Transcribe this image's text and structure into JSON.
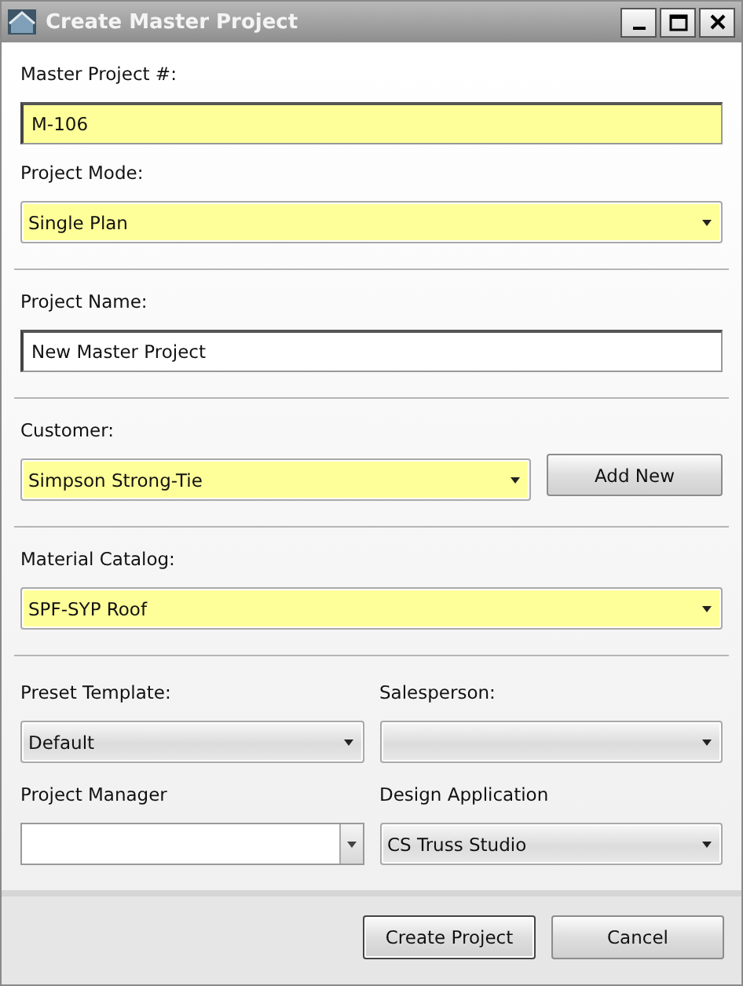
{
  "window": {
    "title": "Create Master Project"
  },
  "sections": [
    {
      "kind": "stack",
      "fields": [
        {
          "label": "Master Project #:",
          "kind": "text",
          "value": "M-106",
          "required": true
        },
        {
          "label": "Project Mode:",
          "kind": "dropdown",
          "value": "Single Plan",
          "required": true
        }
      ]
    },
    {
      "kind": "stack",
      "fields": [
        {
          "label": "Project Name:",
          "kind": "text",
          "value": "New Master Project",
          "required": false
        }
      ]
    },
    {
      "kind": "with-button",
      "button": "Add New",
      "fields": [
        {
          "label": "Customer:",
          "kind": "dropdown",
          "value": "Simpson Strong-Tie",
          "required": true
        }
      ]
    },
    {
      "kind": "stack",
      "fields": [
        {
          "label": "Material Catalog:",
          "kind": "dropdown",
          "value": "SPF-SYP Roof",
          "required": true
        }
      ]
    },
    {
      "kind": "grid",
      "fields": [
        {
          "label": "Preset Template:",
          "kind": "dropdown",
          "value": "Default",
          "required": false
        },
        {
          "label": "Salesperson:",
          "kind": "dropdown",
          "required": false
        },
        {
          "label": "Project Manager",
          "kind": "combo",
          "required": false
        },
        {
          "label": "Design Application",
          "kind": "dropdown",
          "value": "CS Truss Studio",
          "required": false
        }
      ]
    }
  ],
  "buttons": [
    {
      "label": "Create Project",
      "default": true
    },
    {
      "label": "Cancel",
      "default": false
    }
  ]
}
